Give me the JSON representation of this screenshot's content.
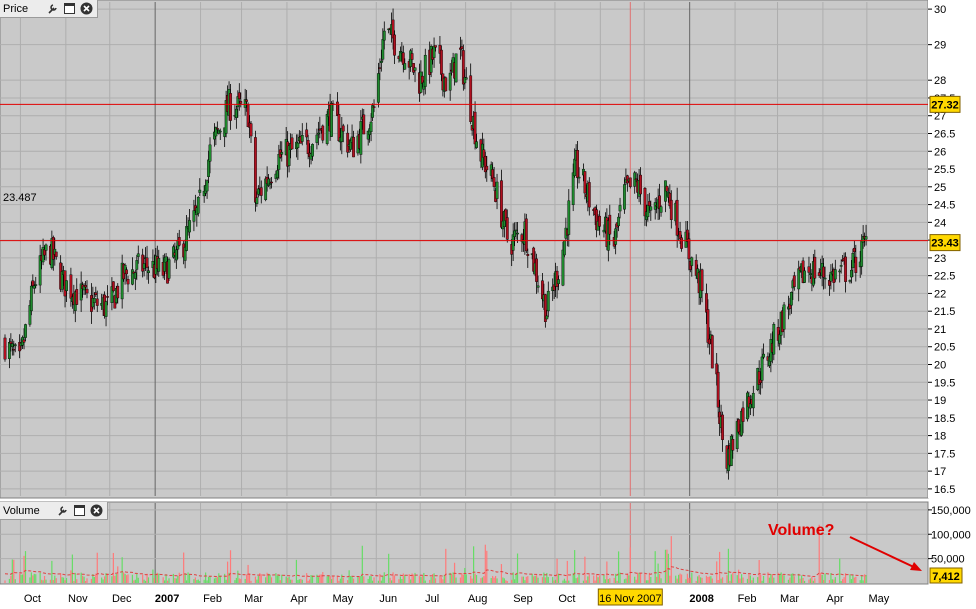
{
  "price_pane": {
    "title": "Price",
    "crosshair_label": "23.487",
    "current_price": "23.43",
    "ref_price": "27.32"
  },
  "volume_pane": {
    "title": "Volume",
    "current_volume": "7,412",
    "annotation": "Volume?"
  },
  "x_axis": {
    "labels": [
      "Oct",
      "Nov",
      "Dec",
      "2007",
      "Feb",
      "Mar",
      "Apr",
      "May",
      "Jun",
      "Jul",
      "Aug",
      "Sep",
      "Oct",
      "16 Nov 2007",
      "2008",
      "Feb",
      "Mar",
      "Apr",
      "May"
    ],
    "highlight": "16 Nov 2007"
  },
  "icons": [
    "wrench-icon",
    "window-icon",
    "close-icon"
  ],
  "colors": {
    "up": "#1f8a2e",
    "down": "#b01020",
    "level_line": "#e00000",
    "pane_bg": "#c9c9c9",
    "label_bg": "#ffd800"
  },
  "chart_data": [
    {
      "type": "candlestick",
      "title": "Price",
      "ylim": [
        16.3,
        30.2
      ],
      "y_ticks": [
        16.5,
        17,
        17.5,
        18,
        18.5,
        19,
        19.5,
        20,
        20.5,
        21,
        21.5,
        22,
        22.5,
        23,
        23.5,
        24,
        24.5,
        25,
        25.5,
        26,
        26.5,
        27,
        27.5,
        28,
        29,
        30
      ],
      "y_tick_labels": [
        "16.5",
        "17",
        "17.5",
        "18",
        "18.5",
        "19",
        "19.5",
        "20",
        "20.5",
        "21",
        "21.5",
        "22",
        "22.5",
        "23",
        "23.5",
        "24",
        "24.5",
        "25",
        "25.5",
        "26",
        "26.5",
        "27",
        "27.5",
        "28",
        "29",
        "30"
      ],
      "close_series": {
        "x": [
          "2006-09-15",
          "2006-09-25",
          "2006-10-05",
          "2006-10-15",
          "2006-10-25",
          "2006-11-10",
          "2006-11-25",
          "2006-12-05",
          "2006-12-20",
          "2007-01-01",
          "2007-01-10",
          "2007-01-25",
          "2007-02-02",
          "2007-02-15",
          "2007-02-28",
          "2007-03-05",
          "2007-03-20",
          "2007-04-10",
          "2007-04-25",
          "2007-05-10",
          "2007-05-25",
          "2007-06-01",
          "2007-06-15",
          "2007-06-25",
          "2007-07-05",
          "2007-07-15",
          "2007-07-22",
          "2007-08-05",
          "2007-08-15",
          "2007-08-25",
          "2007-09-05",
          "2007-09-20",
          "2007-09-30",
          "2007-10-10",
          "2007-10-25",
          "2007-11-05",
          "2007-11-12",
          "2007-11-20",
          "2007-11-30",
          "2007-12-10",
          "2007-12-20",
          "2008-01-03",
          "2008-01-12",
          "2008-01-20",
          "2008-02-01",
          "2008-02-15",
          "2008-03-01",
          "2008-03-15",
          "2008-04-01",
          "2008-04-15",
          "2008-04-25"
        ],
        "close": [
          20.6,
          20.0,
          22.3,
          23.3,
          22.3,
          21.8,
          21.6,
          22.5,
          22.8,
          22.6,
          23.0,
          24.3,
          26.0,
          27.3,
          27.1,
          24.6,
          25.8,
          26.2,
          27.0,
          26.1,
          27.2,
          29.4,
          28.8,
          28.0,
          28.7,
          27.8,
          28.9,
          26.0,
          25.1,
          23.4,
          23.8,
          21.5,
          23.0,
          25.6,
          24.0,
          23.4,
          24.8,
          25.1,
          24.1,
          25.0,
          23.8,
          22.2,
          20.0,
          17.2,
          18.7,
          20.0,
          21.5,
          22.7,
          22.5,
          22.7,
          23.43
        ]
      },
      "horizontal_lines": [
        27.32,
        23.487
      ],
      "vertical_lines": [
        "2007-01-01",
        "2007-11-16",
        "2008-01-01"
      ],
      "last_price": 23.43
    },
    {
      "type": "bar",
      "title": "Volume",
      "ylim": [
        0,
        160000
      ],
      "y_ticks": [
        50000,
        100000,
        150000
      ],
      "y_tick_labels": [
        "50,000",
        "100,000",
        "150,000"
      ],
      "last_value": 7412,
      "moving_average": true
    }
  ]
}
